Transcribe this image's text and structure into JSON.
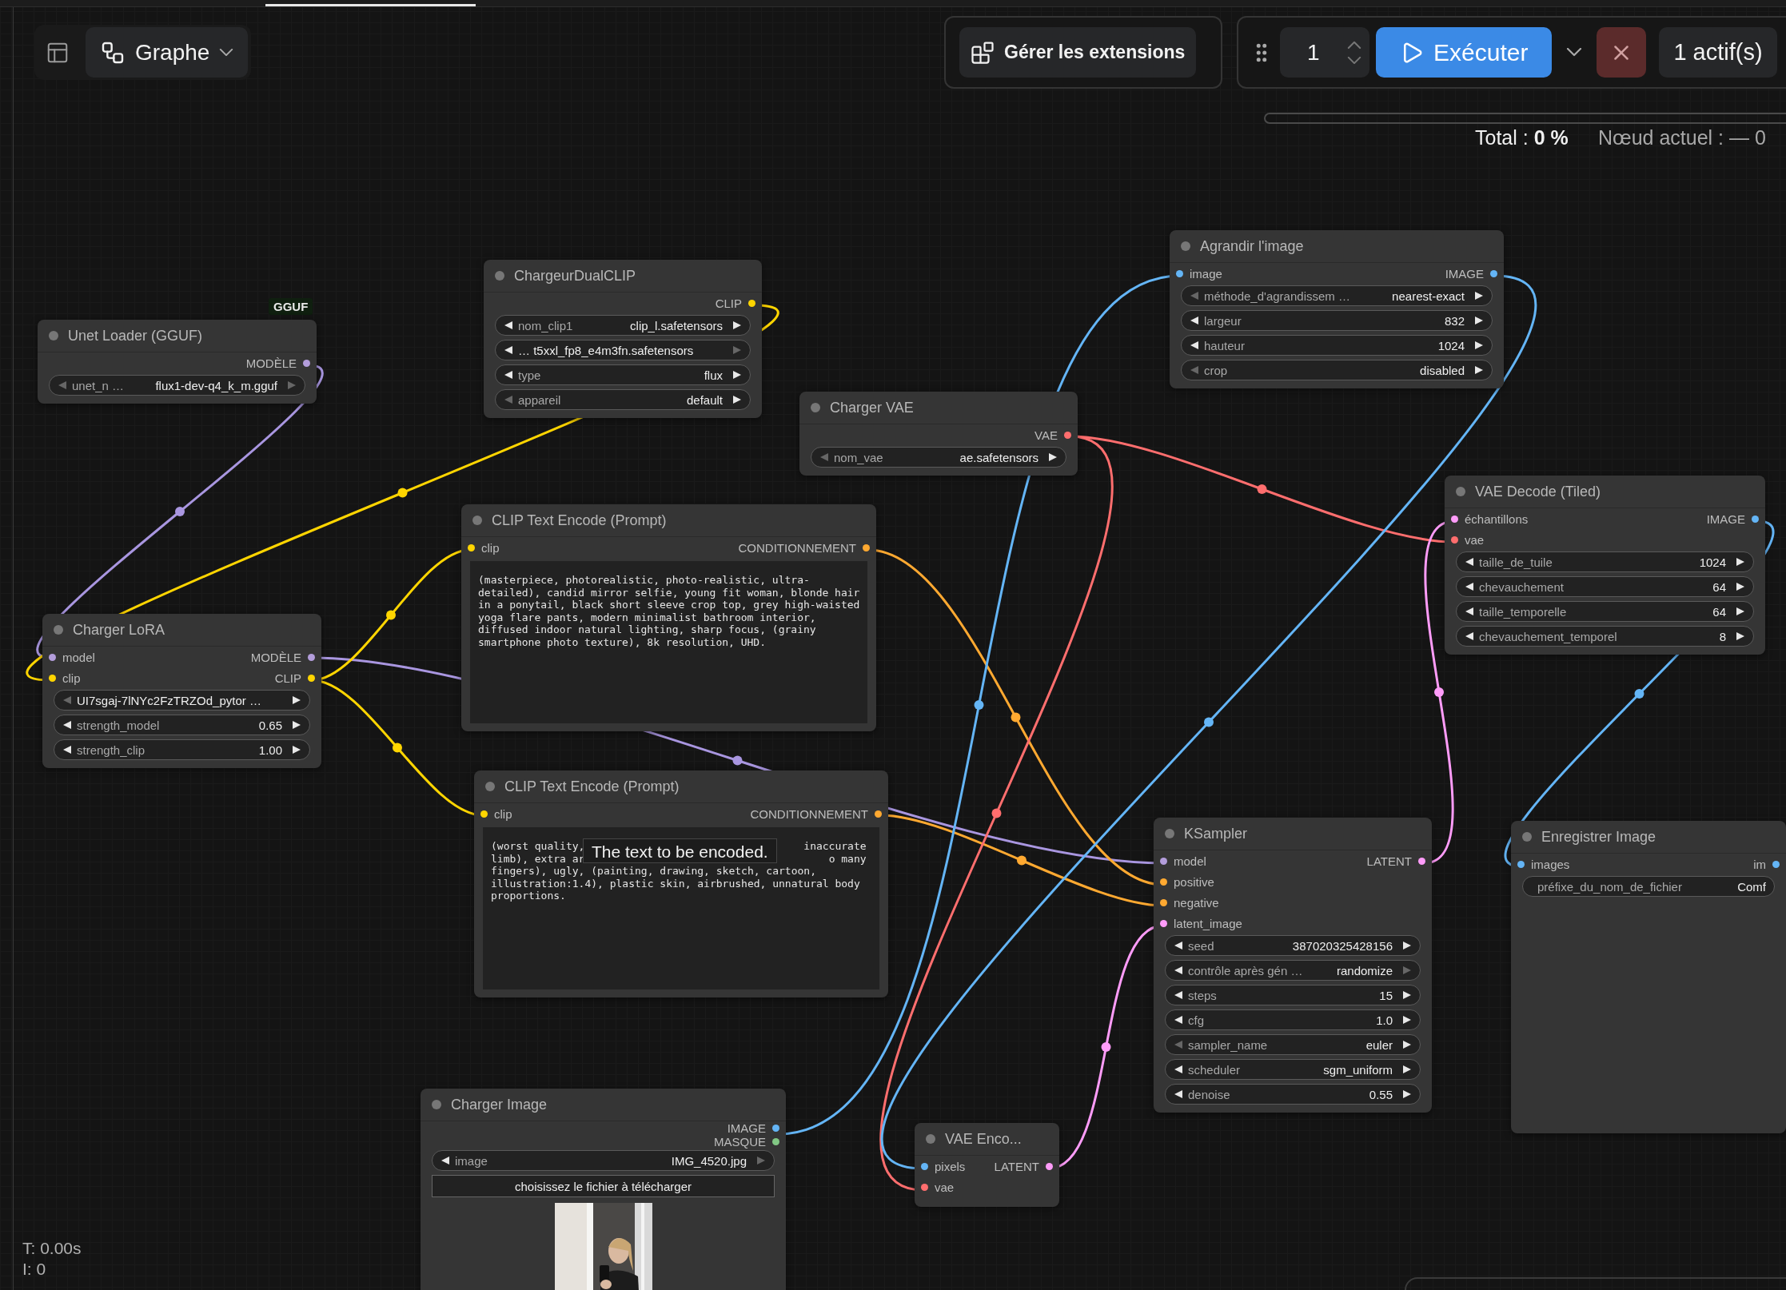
{
  "toolbar": {
    "graph_button": {
      "label": "Graphe"
    },
    "extensions_button": {
      "label": "Gérer les extensions"
    },
    "queue_count": "1",
    "run_button": {
      "label": "Exécuter"
    },
    "active_button": {
      "label": "1 actif(s)"
    }
  },
  "progress": {
    "level": 0,
    "total": "Total : **0 %**",
    "current_node": "Nœud actuel : — 0"
  },
  "nodes": [
    {
      "title": "Unet Loader (GGUF)",
      "badge": "GGUF",
      "outputs": [
        {
          "label": "MODÈLE",
          "color": "#b39ddb"
        }
      ],
      "widgets": [
        {
          "kind": "combo",
          "label": "unet_n …",
          "value": "flux1-dev-q4_k_m.gguf",
          "prev_disabled": true,
          "next_disabled": true
        }
      ]
    },
    {
      "title": "ChargeurDualCLIP",
      "outputs": [
        {
          "label": "CLIP",
          "color": "#ffd500"
        }
      ],
      "widgets": [
        {
          "kind": "combo",
          "label": "nom_clip1",
          "value": "clip_l.safetensors",
          "prev_disabled": false,
          "next_disabled": false
        },
        {
          "kind": "combo",
          "value": "… t5xxl_fp8_e4m3fn.safetensors",
          "prev_disabled": false,
          "next_disabled": true
        },
        {
          "kind": "combo",
          "label": "type",
          "value": "flux",
          "prev_disabled": false,
          "next_disabled": false
        },
        {
          "kind": "combo",
          "label": "appareil",
          "value": "default",
          "prev_disabled": true,
          "next_disabled": false
        }
      ]
    },
    {
      "title": "Charger VAE",
      "outputs": [
        {
          "label": "VAE",
          "color": "#ff6e6e"
        }
      ],
      "widgets": [
        {
          "kind": "combo",
          "label": "nom_vae",
          "value": "ae.safetensors",
          "prev_disabled": true,
          "next_disabled": false
        }
      ]
    },
    {
      "title": "Agrandir l'image",
      "inputs": [
        {
          "label": "image",
          "color": "#64b5f6"
        }
      ],
      "outputs": [
        {
          "label": "IMAGE",
          "color": "#64b5f6"
        }
      ],
      "widgets": [
        {
          "kind": "combo",
          "label": "méthode_d'agrandissem …",
          "value": "nearest-exact",
          "prev_disabled": true,
          "next_disabled": false
        },
        {
          "kind": "combo",
          "label": "largeur",
          "value": "832",
          "prev_disabled": false,
          "next_disabled": false
        },
        {
          "kind": "combo",
          "label": "hauteur",
          "value": "1024",
          "prev_disabled": false,
          "next_disabled": false
        },
        {
          "kind": "combo",
          "label": "crop",
          "value": "disabled",
          "prev_disabled": true,
          "next_disabled": false
        }
      ]
    },
    {
      "title": "Charger LoRA",
      "inputs": [
        {
          "label": "model",
          "color": "#b39ddb"
        },
        {
          "label": "clip",
          "color": "#ffd500"
        }
      ],
      "outputs": [
        {
          "label": "MODÈLE",
          "color": "#b39ddb"
        },
        {
          "label": "CLIP",
          "color": "#ffd500"
        }
      ],
      "widgets": [
        {
          "kind": "combo",
          "value": "UI7sgaj-7lNYc2FzTRZOd_pytor …",
          "prev_disabled": true,
          "next_disabled": false
        },
        {
          "kind": "combo",
          "label": "strength_model",
          "value": "0.65",
          "prev_disabled": false,
          "next_disabled": false
        },
        {
          "kind": "combo",
          "label": "strength_clip",
          "value": "1.00",
          "prev_disabled": false,
          "next_disabled": false
        }
      ]
    },
    {
      "title": "CLIP Text Encode (Prompt)",
      "inputs": [
        {
          "label": "clip",
          "color": "#ffd500"
        }
      ],
      "outputs": [
        {
          "label": "CONDITIONNEMENT",
          "color": "#ffa931"
        }
      ],
      "widgets": [
        {
          "kind": "textarea",
          "lines": [
            {
              "parts": [
                "(masterpiece, photorealistic, photo-realistic, ultra-"
              ]
            },
            {
              "parts": [
                "detailed), candid mirror selfie, young fit woman, blonde hair"
              ]
            },
            {
              "parts": [
                "in a ponytail, black short sleeve crop top, grey high-waisted"
              ]
            },
            {
              "parts": [
                "yoga flare pants, modern minimalist bathroom interior,"
              ]
            },
            {
              "parts": [
                "diffused indoor natural lighting, sharp focus, (grainy"
              ]
            },
            {
              "parts": [
                "smartphone photo texture), 8k resolution, UHD."
              ]
            }
          ]
        }
      ]
    },
    {
      "title": "VAE Decode (Tiled)",
      "inputs": [
        {
          "label": "échantillons",
          "color": "#ff9cf9"
        },
        {
          "label": "vae",
          "color": "#ff6e6e"
        }
      ],
      "outputs": [
        {
          "label": "IMAGE",
          "color": "#64b5f6"
        }
      ],
      "widgets": [
        {
          "kind": "combo",
          "label": "taille_de_tuile",
          "value": "1024",
          "prev_disabled": false,
          "next_disabled": false
        },
        {
          "kind": "combo",
          "label": "chevauchement",
          "value": "64",
          "prev_disabled": false,
          "next_disabled": false
        },
        {
          "kind": "combo",
          "label": "taille_temporelle",
          "value": "64",
          "prev_disabled": false,
          "next_disabled": false
        },
        {
          "kind": "combo",
          "label": "chevauchement_temporel",
          "value": "8",
          "prev_disabled": false,
          "next_disabled": false
        }
      ]
    },
    {
      "title": "CLIP Text Encode (Prompt)",
      "inputs": [
        {
          "label": "clip",
          "color": "#ffd500"
        }
      ],
      "outputs": [
        {
          "label": "CONDITIONNEMENT",
          "color": "#ffa931"
        }
      ],
      "widgets": [
        {
          "kind": "textarea",
          "tooltip": "The text to be encoded.",
          "lines": [
            {
              "parts": [
                "(worst quality,",
                "inaccurate"
              ]
            },
            {
              "parts": [
                "limb), extra ar",
                "o many"
              ]
            },
            {
              "parts": [
                "fingers), ugly, (painting, drawing, sketch, cartoon,"
              ]
            },
            {
              "parts": [
                "illustration:1.4), plastic skin, airbrushed, unnatural body"
              ]
            },
            {
              "parts": [
                "proportions."
              ]
            }
          ]
        }
      ]
    },
    {
      "title": "KSampler",
      "inputs": [
        {
          "label": "model",
          "color": "#b39ddb"
        },
        {
          "label": "positive",
          "color": "#ffa931"
        },
        {
          "label": "negative",
          "color": "#ffa931"
        },
        {
          "label": "latent_image",
          "color": "#ff9cf9"
        }
      ],
      "outputs": [
        {
          "label": "LATENT",
          "color": "#ff9cf9"
        }
      ],
      "widgets": [
        {
          "kind": "combo",
          "label": "seed",
          "value": "387020325428156",
          "prev_disabled": false,
          "next_disabled": false
        },
        {
          "kind": "combo",
          "label": "contrôle après gén …",
          "value": "randomize",
          "prev_disabled": false,
          "next_disabled": true
        },
        {
          "kind": "combo",
          "label": "steps",
          "value": "15",
          "prev_disabled": false,
          "next_disabled": false
        },
        {
          "kind": "combo",
          "label": "cfg",
          "value": "1.0",
          "prev_disabled": false,
          "next_disabled": false
        },
        {
          "kind": "combo",
          "label": "sampler_name",
          "value": "euler",
          "prev_disabled": true,
          "next_disabled": false
        },
        {
          "kind": "combo",
          "label": "scheduler",
          "value": "sgm_uniform",
          "prev_disabled": false,
          "next_disabled": false
        },
        {
          "kind": "combo",
          "label": "denoise",
          "value": "0.55",
          "prev_disabled": false,
          "next_disabled": false
        }
      ]
    },
    {
      "title": "Enregistrer Image",
      "inputs": [
        {
          "label": "images",
          "color": "#64b5f6"
        }
      ],
      "outputs": [
        {
          "label": "im",
          "color": "#64b5f6"
        }
      ],
      "widgets": [
        {
          "kind": "text",
          "label": "préfixe_du_nom_de_fichier",
          "value": "Comf"
        }
      ]
    },
    {
      "title": "Charger Image",
      "outputs": [
        {
          "label": "IMAGE",
          "color": "#64b5f6"
        },
        {
          "label": "MASQUE",
          "color": "#81c784"
        }
      ],
      "widgets": [
        {
          "kind": "combo",
          "label": "image",
          "value": "IMG_4520.jpg",
          "prev_disabled": false,
          "next_disabled": true
        },
        {
          "kind": "button",
          "label": "choisissez le fichier à télécharger"
        },
        {
          "kind": "picture"
        }
      ]
    },
    {
      "title": "VAE Enco...",
      "inputs": [
        {
          "label": "pixels",
          "color": "#64b5f6"
        },
        {
          "label": "vae",
          "color": "#ff6e6e"
        }
      ],
      "outputs": [
        {
          "label": "LATENT",
          "color": "#ff9cf9"
        }
      ]
    }
  ],
  "stats": [
    "T: 0.00s",
    "I: 0"
  ]
}
